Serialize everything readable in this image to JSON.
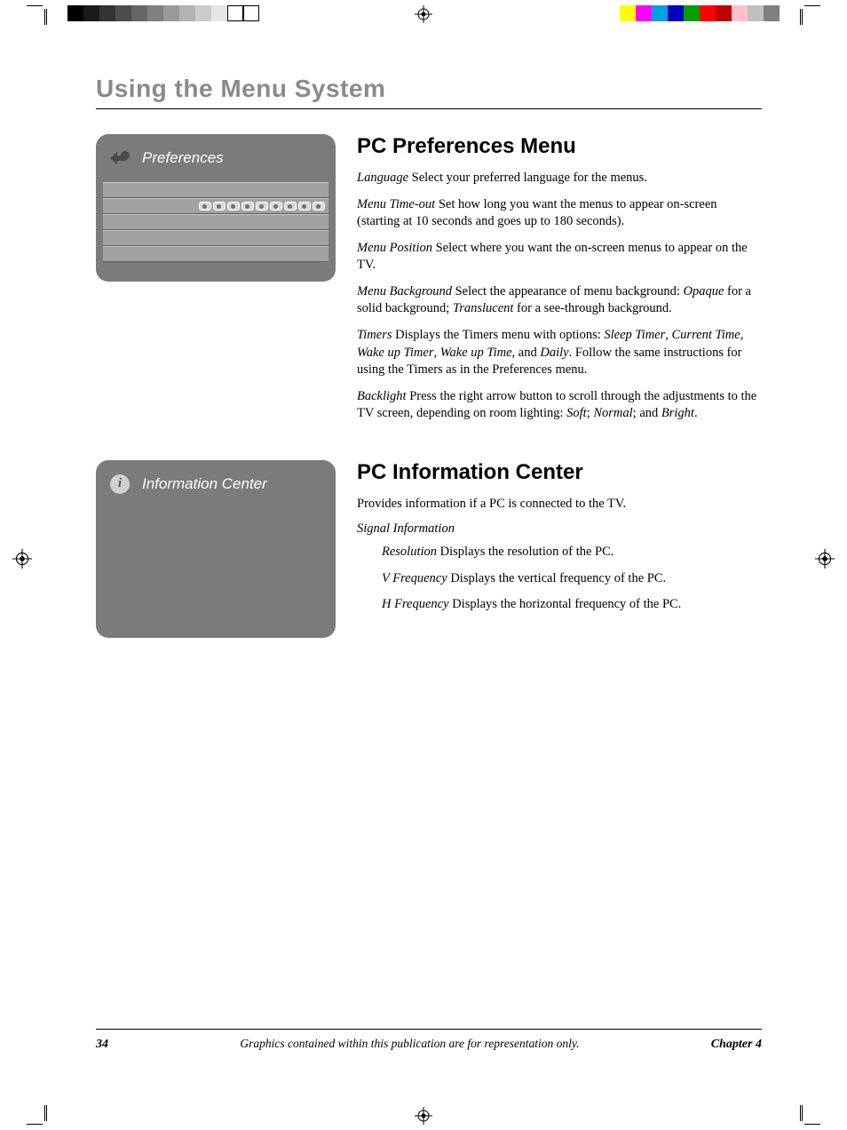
{
  "page_title": "Using the Menu System",
  "grayswatch_colors": [
    "#000000",
    "#1a1a1a",
    "#333333",
    "#4d4d4d",
    "#666666",
    "#808080",
    "#999999",
    "#b3b3b3",
    "#cccccc",
    "#e6e6e6",
    "#ffffff",
    "#ffffff"
  ],
  "colorswatch_colors": [
    "#ffff00",
    "#ff00ff",
    "#00a0e0",
    "#0000c0",
    "#00a000",
    "#ff0000",
    "#c00000",
    "#ffc0cb",
    "#c0c0c0",
    "#808080"
  ],
  "panel1": {
    "title": "Preferences",
    "icon_name": "preferences-icon",
    "rows": 5
  },
  "section1": {
    "heading": "PC Preferences Menu",
    "items": [
      {
        "term": "Language",
        "text": "   Select your preferred language for the menus."
      },
      {
        "term": "Menu Time-out",
        "text": "   Set how long you want the menus to appear on-screen (starting at 10 seconds and goes up to 180 seconds)."
      },
      {
        "term": "Menu Position",
        "text": "   Select where you want the on-screen menus to appear on the TV."
      },
      {
        "term": "Menu Background",
        "text_html": "   Select the appearance of menu background: <i>Opaque</i> for a solid background; <i>Translucent</i> for a see-through background."
      },
      {
        "term": "Timers",
        "text_html": "  Displays the Timers menu with options: <i>Sleep Timer</i>, <i>Current Time</i>, <i>Wake up Timer</i>, <i>Wake up Time,</i> and <i>Daily</i>. Follow the same instructions for using the Timers as in the Preferences menu."
      },
      {
        "term": "Backlight",
        "text_html": "   Press the right arrow button to scroll through the adjustments to the TV screen, depending on room lighting: <i>Soft</i>; <i>Normal</i>; and <i>Bright</i>."
      }
    ]
  },
  "panel2": {
    "title": "Information Center",
    "icon_name": "info-icon"
  },
  "section2": {
    "heading": "PC Information Center",
    "intro": "Provides information if a PC is connected to the TV.",
    "sub_head": "Signal Information",
    "rows": [
      {
        "term": "Resolution",
        "text": "   Displays the resolution of the PC."
      },
      {
        "term": "V Frequency",
        "text": "   Displays the vertical frequency of the PC."
      },
      {
        "term": "H Frequency",
        "text": "   Displays the horizontal frequency of the PC."
      }
    ]
  },
  "footer": {
    "page_number": "34",
    "caption": "Graphics contained within this publication are for representation only.",
    "chapter": "Chapter 4"
  }
}
